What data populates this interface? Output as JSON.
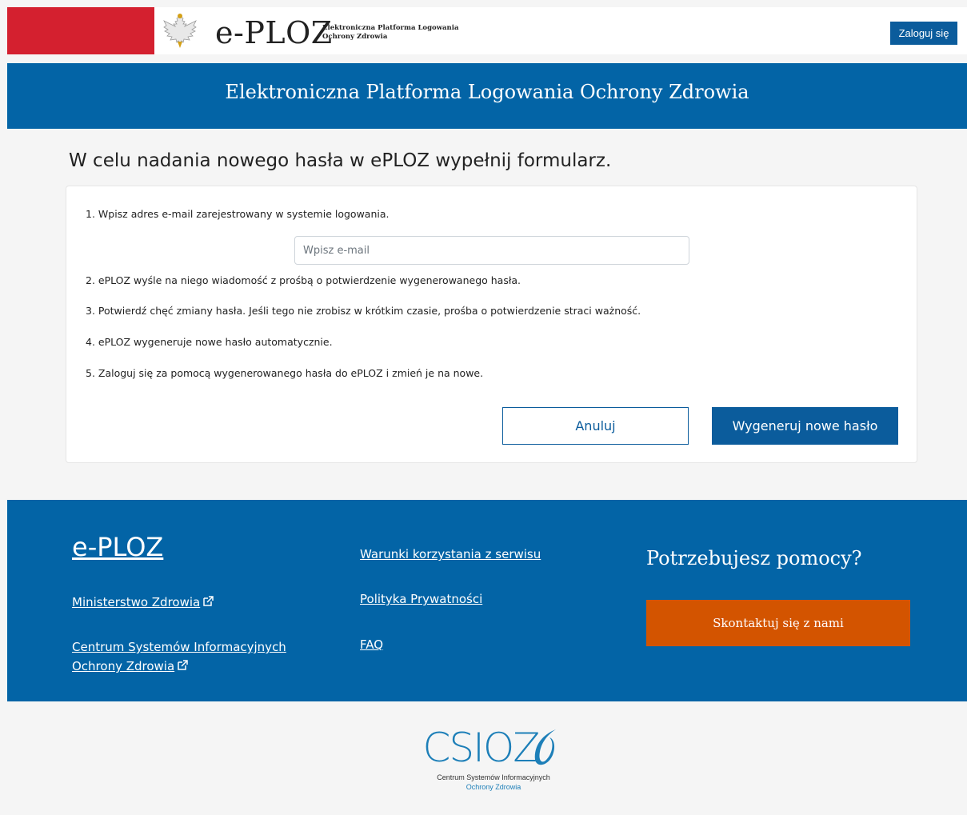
{
  "header": {
    "logo_main": "e-PLOZ",
    "logo_sub_line1": "Elektroniczna Platforma Logowania",
    "logo_sub_line2": "Ochrony Zdrowia",
    "login_label": "Zaloguj się"
  },
  "banner": {
    "title": "Elektroniczna Platforma Logowania Ochrony Zdrowia"
  },
  "main": {
    "heading": "W celu nadania nowego hasła w ePLOZ wypełnij formularz.",
    "steps": [
      "1. Wpisz adres e-mail zarejestrowany w systemie logowania.",
      "2. ePLOZ wyśle na niego wiadomość z prośbą o potwierdzenie wygenerowanego hasła.",
      "3. Potwierdź chęć zmiany hasła. Jeśli tego nie zrobisz w krótkim czasie, prośba o potwierdzenie straci ważność.",
      "4. ePLOZ wygeneruje nowe hasło automatycznie.",
      "5. Zaloguj się za pomocą wygenerowanego hasła do ePLOZ i zmień je na nowe."
    ],
    "email_placeholder": "Wpisz e-mail",
    "email_value": "",
    "cancel_label": "Anuluj",
    "generate_label": "Wygeneruj nowe hasło"
  },
  "footer": {
    "brand": "e-PLOZ",
    "links_left": [
      "Ministerstwo Zdrowia",
      "Centrum Systemów Informacyjnych",
      "Ochrony Zdrowia"
    ],
    "links_middle": [
      "Warunki korzystania z serwisu",
      "Polityka Prywatności",
      "FAQ"
    ],
    "help_title": "Potrzebujesz pomocy?",
    "contact_label": "Skontaktuj się z nami"
  },
  "bottom_logo": {
    "name": "CSIOZ",
    "line1": "Centrum Systemów Informacyjnych",
    "line2": "Ochrony Zdrowia"
  },
  "icons": {
    "eagle": "polish-eagle-icon",
    "external": "external-link-icon"
  },
  "colors": {
    "brand_blue": "#0364a6",
    "button_blue": "#0b5c9c",
    "red_bar": "#d4202f",
    "contact_orange": "#d35400"
  }
}
